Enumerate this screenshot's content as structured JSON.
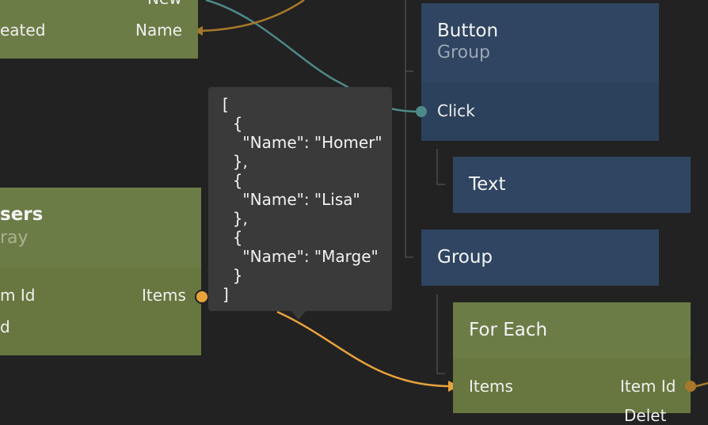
{
  "nodes": {
    "topleft": {
      "port_left": "eated",
      "port_right": "Name",
      "port_top": "New"
    },
    "users": {
      "title": "sers",
      "subtitle": "ray",
      "port_itemid": "m Id",
      "port_d": "d",
      "port_items": "Items"
    },
    "button": {
      "title": "Button",
      "subtitle": "Group",
      "port_click": "Click"
    },
    "text": {
      "title": "Text"
    },
    "group": {
      "title": "Group"
    },
    "foreach": {
      "title": "For Each",
      "port_items": "Items",
      "port_itemid": "Item Id",
      "port_partial": "Delet"
    }
  },
  "tooltip": {
    "text": "[\n  {\n    \"Name\": \"Homer\"\n  },\n  {\n    \"Name\": \"Lisa\"\n  },\n  {\n    \"Name\": \"Marge\"\n  }\n]"
  },
  "colors": {
    "green_node": "#6c7c47",
    "blue_node": "#2f4561",
    "wire_teal": "#4f8a8a",
    "wire_orange": "#e8a33d",
    "wire_brown": "#a8792b",
    "background": "#222222"
  }
}
